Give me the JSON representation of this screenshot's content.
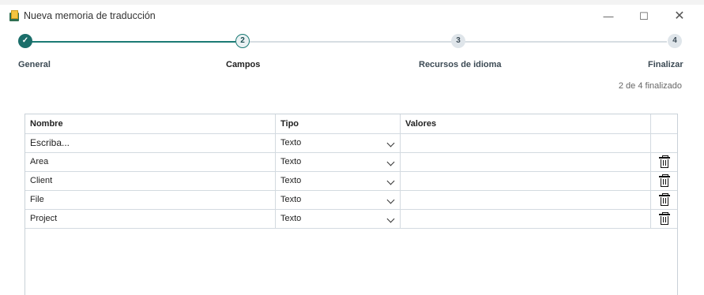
{
  "window": {
    "title": "Nueva memoria de traducción"
  },
  "stepper": {
    "steps": [
      {
        "number": "✓",
        "label": "General",
        "state": "done"
      },
      {
        "number": "2",
        "label": "Campos",
        "state": "current"
      },
      {
        "number": "3",
        "label": "Recursos de idioma",
        "state": "todo"
      },
      {
        "number": "4",
        "label": "Finalizar",
        "state": "todo"
      }
    ],
    "progress_text": "2 de 4 finalizado"
  },
  "table": {
    "columns": [
      "Nombre",
      "Tipo",
      "Valores"
    ],
    "new_row_placeholder": "Escriba...",
    "new_row_type": "Texto",
    "rows": [
      {
        "name": "Area",
        "type": "Texto",
        "values": ""
      },
      {
        "name": "Client",
        "type": "Texto",
        "values": ""
      },
      {
        "name": "File",
        "type": "Texto",
        "values": ""
      },
      {
        "name": "Project",
        "type": "Texto",
        "values": ""
      }
    ]
  },
  "colors": {
    "accent": "#1b7a74",
    "grid_border": "#c9d1d8"
  },
  "icons": {
    "delete": "trash-icon",
    "dropdown": "chevron-down-icon"
  }
}
